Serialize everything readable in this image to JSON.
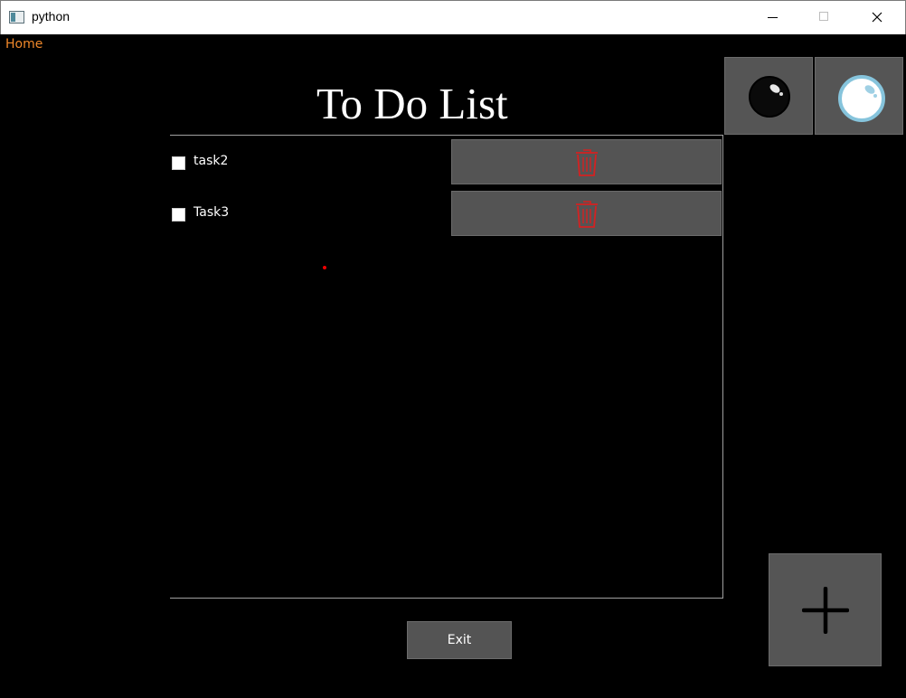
{
  "window": {
    "title": "python",
    "controls": [
      "minimize-icon",
      "maximize-icon",
      "close-icon"
    ]
  },
  "nav": {
    "home_label": "Home",
    "home_color": "#f0882a"
  },
  "page": {
    "title": "To Do List"
  },
  "theme_buttons": [
    {
      "icon": "dark-theme-orb-icon"
    },
    {
      "icon": "light-theme-orb-icon"
    }
  ],
  "tasks": [
    {
      "label": "task2",
      "checked": false,
      "delete_icon": "trash-icon"
    },
    {
      "label": "Task3",
      "checked": false,
      "delete_icon": "trash-icon"
    }
  ],
  "footer": {
    "exit_label": "Exit",
    "add_icon": "plus-icon"
  },
  "colors": {
    "background": "#000000",
    "button": "#555555",
    "delete_icon": "#d42121",
    "text": "#ffffff"
  }
}
